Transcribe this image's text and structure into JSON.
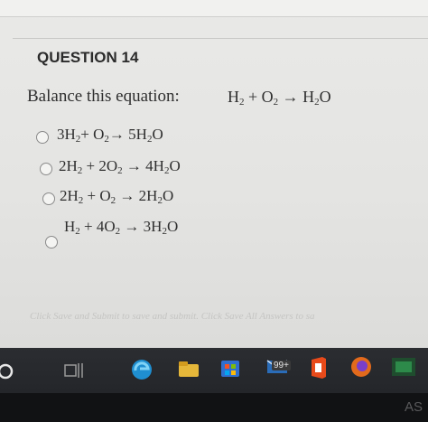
{
  "question": {
    "number_label": "QUESTION 14",
    "prompt": "Balance this equation:",
    "equation": {
      "r1": "H",
      "r1s": "2",
      "plus": " + O",
      "r2s": "2",
      "arrow": " → H",
      "p1s": "2",
      "p1": "O"
    }
  },
  "options": [
    {
      "a": "3H",
      "as": "2",
      "b": "+ O",
      "bs": "2",
      "c": "→  5H",
      "cs": "2",
      "d": "O"
    },
    {
      "a": "2H",
      "as": "2",
      "b": " + 2O",
      "bs": "2",
      "c": " →  4H",
      "cs": "2",
      "d": "O"
    },
    {
      "a": "2H",
      "as": "2",
      "b": " + O",
      "bs": "2",
      "c": " →  2H",
      "cs": "2",
      "d": "O"
    },
    {
      "a": "H",
      "as": "2",
      "b": " + 4O",
      "bs": "2",
      "c": " →  3H",
      "cs": "2",
      "d": "O"
    }
  ],
  "footer": {
    "note": "Click Save and Submit to save and submit. Click Save All Answers to sa"
  },
  "taskbar": {
    "badge": "99+"
  },
  "corner_text": "AS"
}
